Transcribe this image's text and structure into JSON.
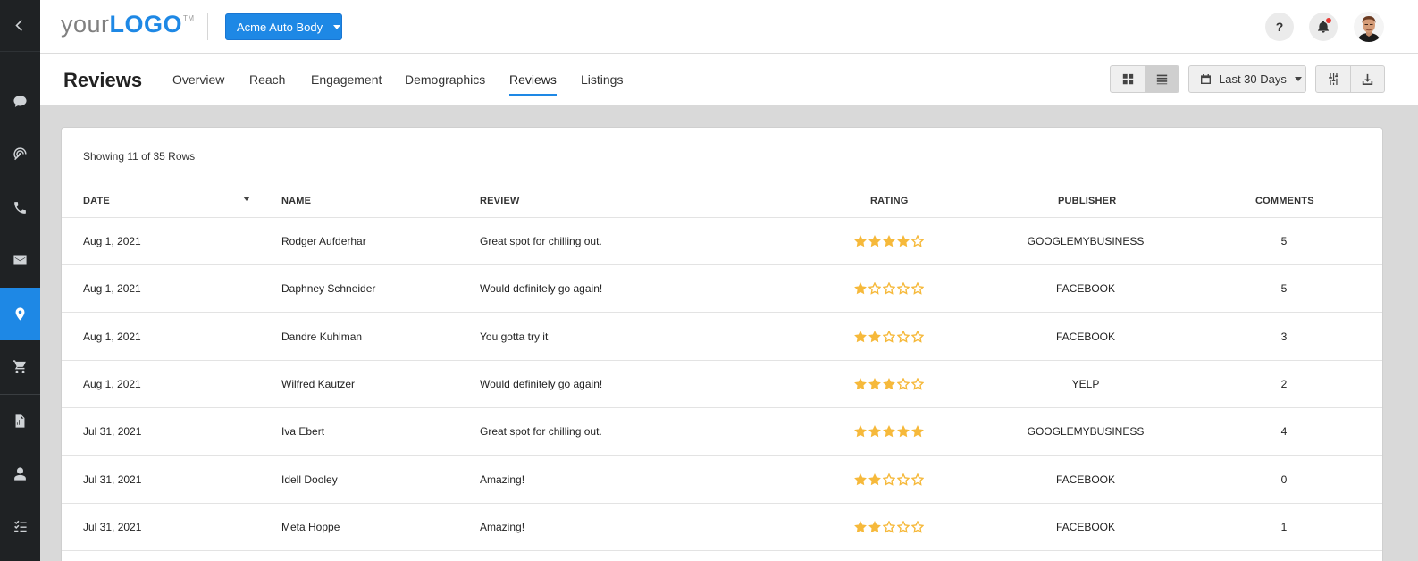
{
  "header": {
    "logo_pre": "your",
    "logo_strong": "LOGO",
    "logo_tm": "TM",
    "account_label": "Acme Auto Body",
    "help_label": "?"
  },
  "subheader": {
    "title": "Reviews",
    "tabs": [
      {
        "label": "Overview"
      },
      {
        "label": "Reach"
      },
      {
        "label": "Engagement"
      },
      {
        "label": "Demographics"
      },
      {
        "label": "Reviews"
      },
      {
        "label": "Listings"
      }
    ],
    "active_tab": "Reviews",
    "date_range": "Last 30 Days"
  },
  "table": {
    "showing": "Showing 11 of 35 Rows",
    "columns": [
      "DATE",
      "NAME",
      "REVIEW",
      "RATING",
      "PUBLISHER",
      "COMMENTS"
    ],
    "rows": [
      {
        "date": "Aug 1, 2021",
        "name": "Rodger Aufderhar",
        "review": "Great spot for chilling out.",
        "rating": 4,
        "publisher": "GOOGLEMYBUSINESS",
        "comments": "5"
      },
      {
        "date": "Aug 1, 2021",
        "name": "Daphney Schneider",
        "review": "Would definitely go again!",
        "rating": 1,
        "publisher": "FACEBOOK",
        "comments": "5"
      },
      {
        "date": "Aug 1, 2021",
        "name": "Dandre Kuhlman",
        "review": "You gotta try it",
        "rating": 2,
        "publisher": "FACEBOOK",
        "comments": "3"
      },
      {
        "date": "Aug 1, 2021",
        "name": "Wilfred Kautzer",
        "review": "Would definitely go again!",
        "rating": 3,
        "publisher": "YELP",
        "comments": "2"
      },
      {
        "date": "Jul 31, 2021",
        "name": "Iva Ebert",
        "review": "Great spot for chilling out.",
        "rating": 5,
        "publisher": "GOOGLEMYBUSINESS",
        "comments": "4"
      },
      {
        "date": "Jul 31, 2021",
        "name": "Idell Dooley",
        "review": "Amazing!",
        "rating": 2,
        "publisher": "FACEBOOK",
        "comments": "0"
      },
      {
        "date": "Jul 31, 2021",
        "name": "Meta Hoppe",
        "review": "Amazing!",
        "rating": 2,
        "publisher": "FACEBOOK",
        "comments": "1"
      }
    ]
  },
  "colors": {
    "accent": "#1e88e5",
    "star": "#f6b93b",
    "sidebar": "#1f2224",
    "notification_dot": "#e53935"
  },
  "icons": {
    "sidebar": [
      "chevron-left-icon",
      "chat-icon",
      "broadcast-icon",
      "phone-icon",
      "mail-icon",
      "location-pin-icon",
      "cart-icon",
      "report-icon",
      "user-icon",
      "checklist-icon"
    ],
    "toolbar": [
      "grid-view-icon",
      "list-view-icon",
      "calendar-icon",
      "filter-sliders-icon",
      "download-icon",
      "bell-icon"
    ]
  }
}
